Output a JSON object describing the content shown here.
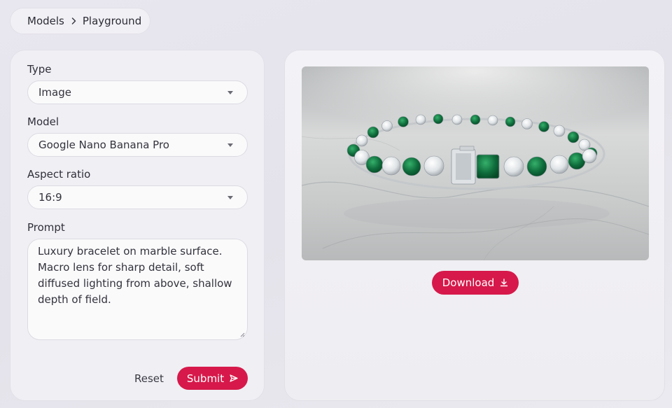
{
  "breadcrumb": {
    "root": "Models",
    "current": "Playground"
  },
  "form": {
    "type_label": "Type",
    "type_value": "Image",
    "model_label": "Model",
    "model_value": "Google Nano Banana Pro",
    "aspect_label": "Aspect ratio",
    "aspect_value": "16:9",
    "prompt_label": "Prompt",
    "prompt_value": "Luxury bracelet on marble surface. Macro lens for sharp detail, soft diffused lighting from above, shallow depth of field.",
    "reset_label": "Reset",
    "submit_label": "Submit"
  },
  "result": {
    "download_label": "Download"
  },
  "icons": {
    "breadcrumb_separator": "chevron-right-icon",
    "select_caret": "caret-down-icon",
    "submit": "send-icon",
    "download": "download-icon"
  },
  "colors": {
    "accent": "#d6194a",
    "panel": "#f0eff4",
    "background": "#e6e4ec"
  }
}
